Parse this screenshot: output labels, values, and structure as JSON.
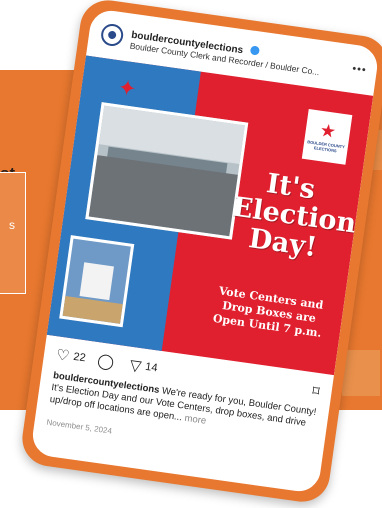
{
  "background": {
    "heading_fragment": "st",
    "card_fragment": "s"
  },
  "post": {
    "account": "bouldercountyelections",
    "subtitle": "Boulder County Clerk and Recorder / Boulder Co...",
    "more": "•••",
    "media": {
      "headline": "It's Election Day!",
      "tagline": "Vote Centers and Drop Boxes are Open Until 7 p.m.",
      "logo_text": "BOULDER COUNTY ELECTIONS",
      "colors": {
        "red": "#e0202f",
        "blue": "#2f79c0"
      }
    },
    "actions": {
      "likes": "22",
      "shares": "14"
    },
    "caption": {
      "user": "bouldercountyelections",
      "text": " We're ready for you, Boulder County! It's Election Day and our Vote Centers, drop boxes, and drive up/drop off locations are open...",
      "more": " more"
    },
    "date": "November 5, 2024"
  },
  "icons": [
    "heart-icon",
    "comment-icon",
    "share-icon",
    "bookmark-icon",
    "verified-icon",
    "star-icon"
  ]
}
